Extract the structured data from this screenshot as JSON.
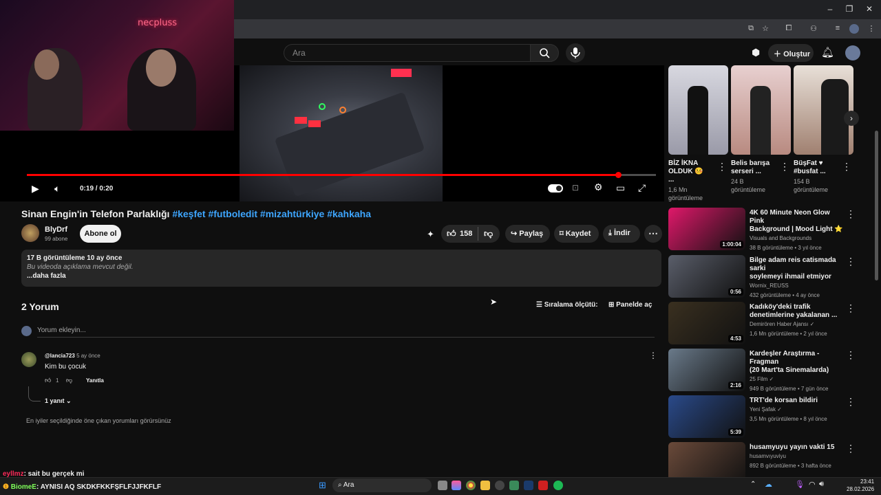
{
  "overlay": {
    "neon_sign": "necpluss"
  },
  "search": {
    "placeholder": "Ara"
  },
  "header": {
    "create_label": "Oluştur"
  },
  "player": {
    "time": "0:19 / 0:20",
    "progress": 0.94
  },
  "video": {
    "title": "Sinan Engin'in Telefon Parlaklığı",
    "hashtags": [
      "#keşfet",
      "#futboledit",
      "#mizahtürkiye",
      "#kahkaha"
    ],
    "channel": "BlyDrf",
    "subs": "99 abone",
    "subscribe_label": "Abone ol",
    "likes": "158",
    "share": "Paylaş",
    "save": "Kaydet",
    "download": "İndir"
  },
  "description": {
    "stats": "17 B görüntüleme  10 ay önce",
    "text": "Bu videoda açıklama mevcut değil.",
    "more": "...daha fazla"
  },
  "comments": {
    "count": "2 Yorum",
    "sort": "Sıralama ölçütü:",
    "panel": "Panelde aç",
    "add_placeholder": "Yorum ekleyin...",
    "items": [
      {
        "author": "@lancia723",
        "time": "5 ay önce",
        "text": "Kim bu çocuk",
        "likes": "1",
        "reply": "Yanıtla",
        "replies": "1 yanıt"
      }
    ],
    "footer": "En iyiler seçildiğinde öne çıkan yorumları görürsünüz"
  },
  "shorts": [
    {
      "title1": "BİZ İKNA",
      "title2": "OLDUK 🤒 ...",
      "views1": "1,6 Mn",
      "views2": "görüntüleme"
    },
    {
      "title1": "Belis barışa",
      "title2": "serseri ...",
      "views1": "24 B",
      "views2": "görüntüleme"
    },
    {
      "title1": "BüşFat ♥",
      "title2": "#busfat ...",
      "views1": "154 B",
      "views2": "görüntüleme"
    }
  ],
  "sidebar": [
    {
      "title1": "4K 60 Minute Neon Glow Pink",
      "title2": "Background | Mood Light ⭐",
      "channel": "Visuals and Backgrounds",
      "meta": "38 B görüntüleme • 3 yıl önce",
      "duration": "1:00:04",
      "color": "#e0186a"
    },
    {
      "title1": "Bilge adam reis catismada sarki",
      "title2": "soylemeyi ihmail etmiyor",
      "channel": "Wornix_REUSS",
      "meta": "432 görüntüleme • 4 ay önce",
      "duration": "0:56",
      "color": "#5a5e6a"
    },
    {
      "title1": "Kadıköy'deki trafik",
      "title2": "denetimlerine yakalanan ...",
      "channel": "Demirören Haber Ajansı ✓",
      "meta": "1,6 Mn görüntüleme • 2 yıl önce",
      "duration": "4:53",
      "color": "#3a3020"
    },
    {
      "title1": "Kardeşler Araştırma - Fragman",
      "title2": "(20 Mart'ta Sinemalarda)",
      "channel": "25 Film ✓",
      "meta": "949 B görüntüleme • 7 gün önce",
      "duration": "2:16",
      "color": "#6a7a8a"
    },
    {
      "title1": "TRT'de korsan bildiri",
      "title2": "",
      "channel": "Yeni Şafak ✓",
      "meta": "3,5 Mn görüntüleme • 8 yıl önce",
      "duration": "5:39",
      "color": "#2a4a8a"
    },
    {
      "title1": "husamyuyu yayın vakti 15",
      "title2": "",
      "channel": "husamvıyuviyu",
      "meta": "892 B görüntüleme • 3 hafta önce",
      "duration": "",
      "color": "#6a4a3a"
    }
  ],
  "chat": [
    {
      "user": "eyllmz",
      "msg": ": sait bu gerçek mi",
      "color": "#ff2a5a"
    },
    {
      "user": "BiomeE",
      "msg": ": AYNISI AQ SKDKFKKFŞFLFJJFKFLF",
      "color": "#7fff5a"
    }
  ],
  "taskbar": {
    "search": "Ara",
    "time": "23:41",
    "date": "28.02.2026"
  }
}
